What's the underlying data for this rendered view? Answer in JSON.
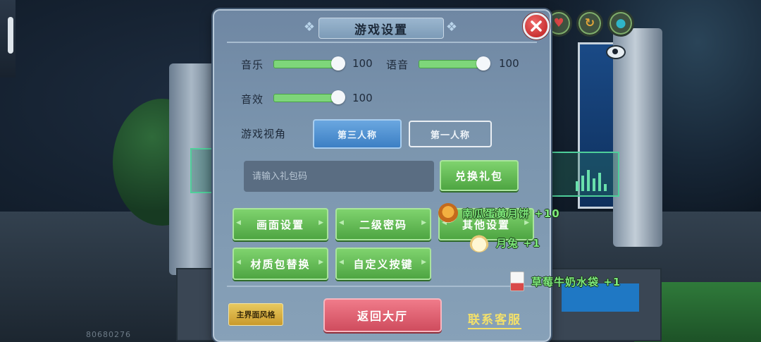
{
  "dialog": {
    "title": "游戏设置",
    "close_label": "关闭"
  },
  "audio": {
    "music_label": "音乐",
    "music_value": "100",
    "voice_label": "语音",
    "voice_value": "100",
    "sfx_label": "音效",
    "sfx_value": "100",
    "music_level": 1.0,
    "voice_level": 1.0,
    "sfx_level": 1.0
  },
  "camera": {
    "label": "游戏视角",
    "options": [
      "第三人称",
      "第一人称"
    ],
    "selected": "第三人称"
  },
  "gift": {
    "placeholder": "请输入礼包码",
    "value": "",
    "redeem_label": "兑换礼包"
  },
  "menu": {
    "graphics_label": "画面设置",
    "password_label": "二级密码",
    "other_label": "其他设置",
    "texture_label": "材质包替换",
    "keys_label": "自定义按键"
  },
  "footer": {
    "style_label": "主界面风格",
    "lobby_label": "返回大厅",
    "support_label": "联系客服"
  },
  "toasts": [
    {
      "icon": "mooncake-icon",
      "text": "南瓜蛋黄月饼 +10"
    },
    {
      "icon": "rabbit-icon",
      "text": "月兔 +1"
    },
    {
      "icon": "milk-bag-icon",
      "text": "草莓牛奶水袋 +1"
    }
  ],
  "background": {
    "player_id": "80680276"
  },
  "colors": {
    "slider_fill": "#7ed67a",
    "button_green": "#5fb852",
    "button_blue": "#4a8fd0",
    "button_red": "#dd5c6d",
    "link_yellow": "#f3e06a",
    "toast_green": "#7ee87a"
  }
}
